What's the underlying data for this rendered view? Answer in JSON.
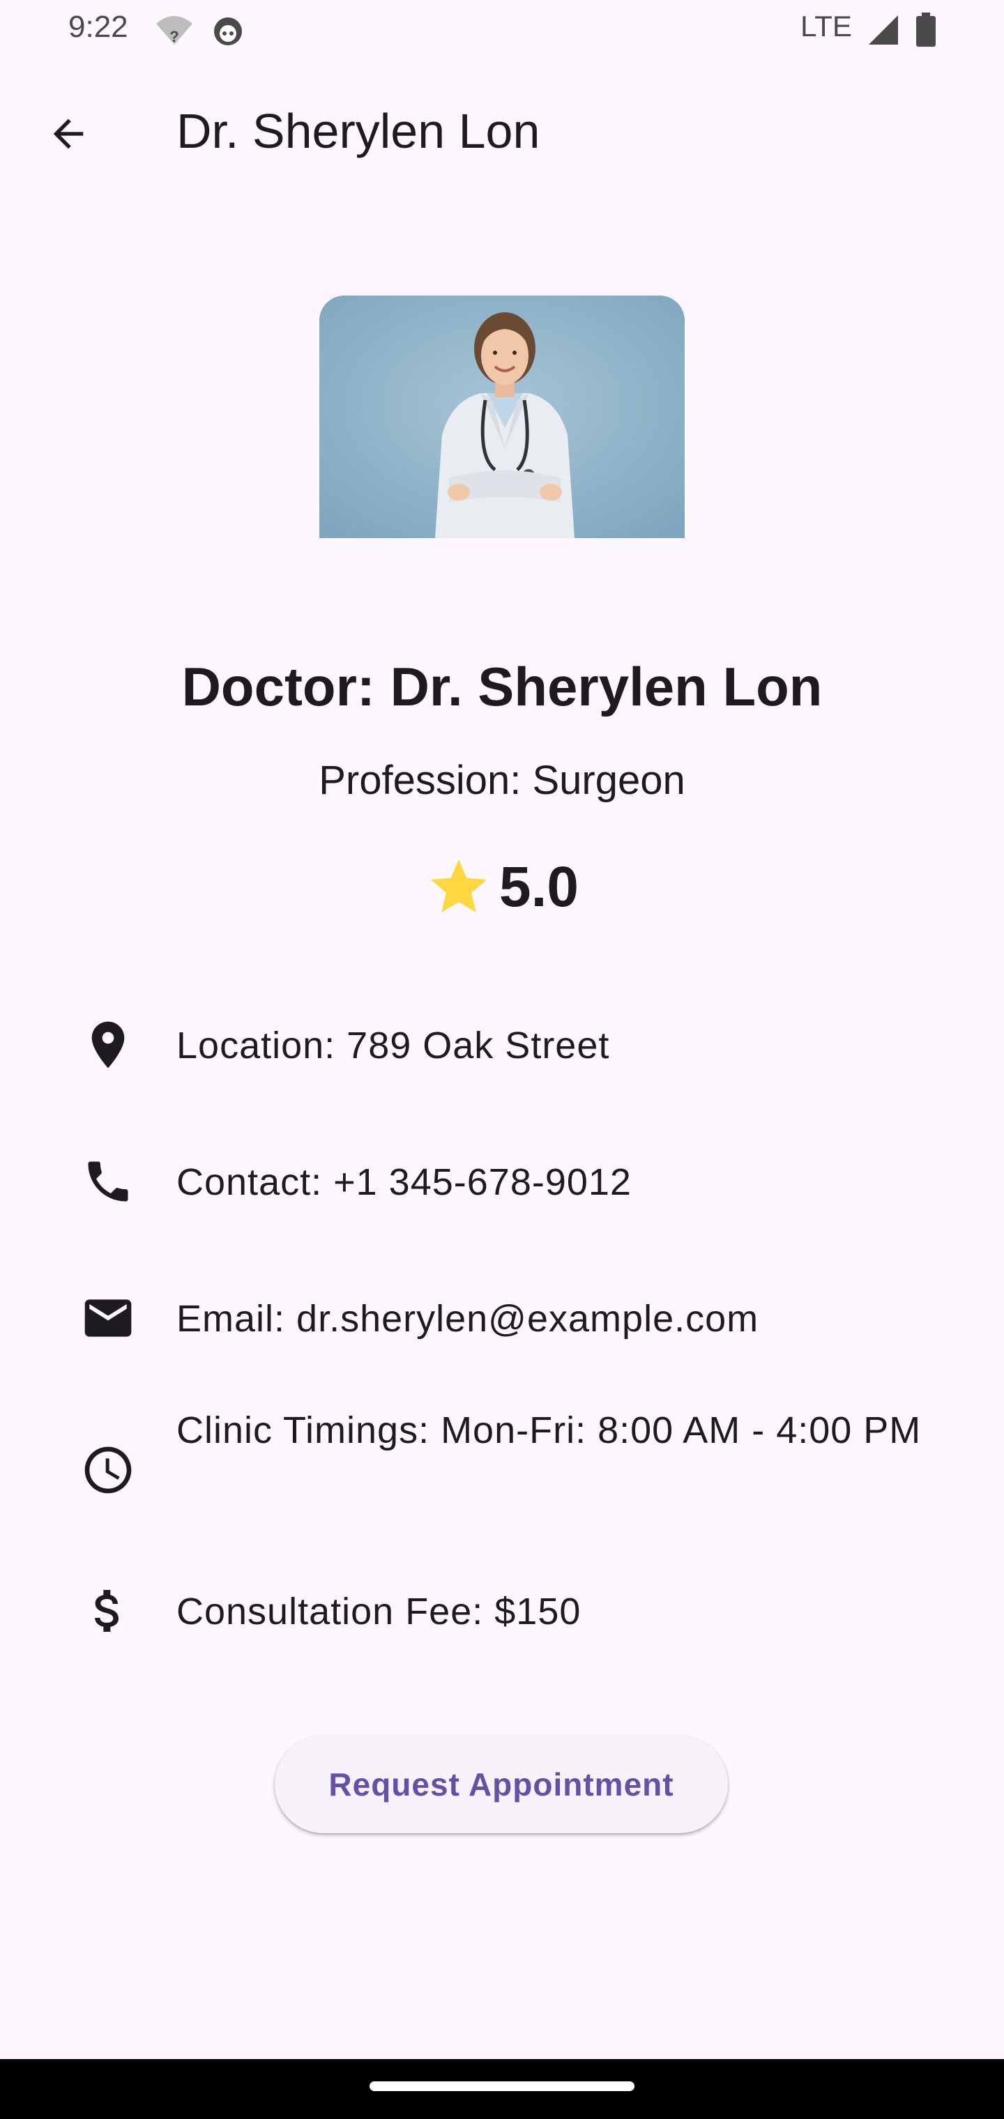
{
  "status_bar": {
    "time": "9:22",
    "network": "LTE",
    "icons": [
      "wifi-question-icon",
      "android-head-icon",
      "cell-signal-icon",
      "battery-icon"
    ]
  },
  "app_bar": {
    "title": "Dr. Sherylen Lon",
    "back_icon": "arrow-back-icon"
  },
  "profile": {
    "name": "Doctor: Dr. Sherylen Lon",
    "profession": "Profession: Surgeon",
    "rating": "5.0",
    "rating_icon": "star-icon",
    "star_color": "#FFD740"
  },
  "details": [
    {
      "icon": "location-pin-icon",
      "text": "Location: 789 Oak Street"
    },
    {
      "icon": "phone-icon",
      "text": "Contact: +1 345-678-9012"
    },
    {
      "icon": "email-icon",
      "text": "Email: dr.sherylen@example.com"
    },
    {
      "icon": "clock-icon",
      "text": "Clinic Timings: Mon-Fri: 8:00 AM - 4:00 PM"
    },
    {
      "icon": "dollar-icon",
      "text": "Consultation Fee: $150"
    }
  ],
  "actions": {
    "request_label": "Request Appointment"
  },
  "colors": {
    "background": "#FEF7FF",
    "primary": "#6750A4",
    "button_surface": "#F7F2FA"
  }
}
